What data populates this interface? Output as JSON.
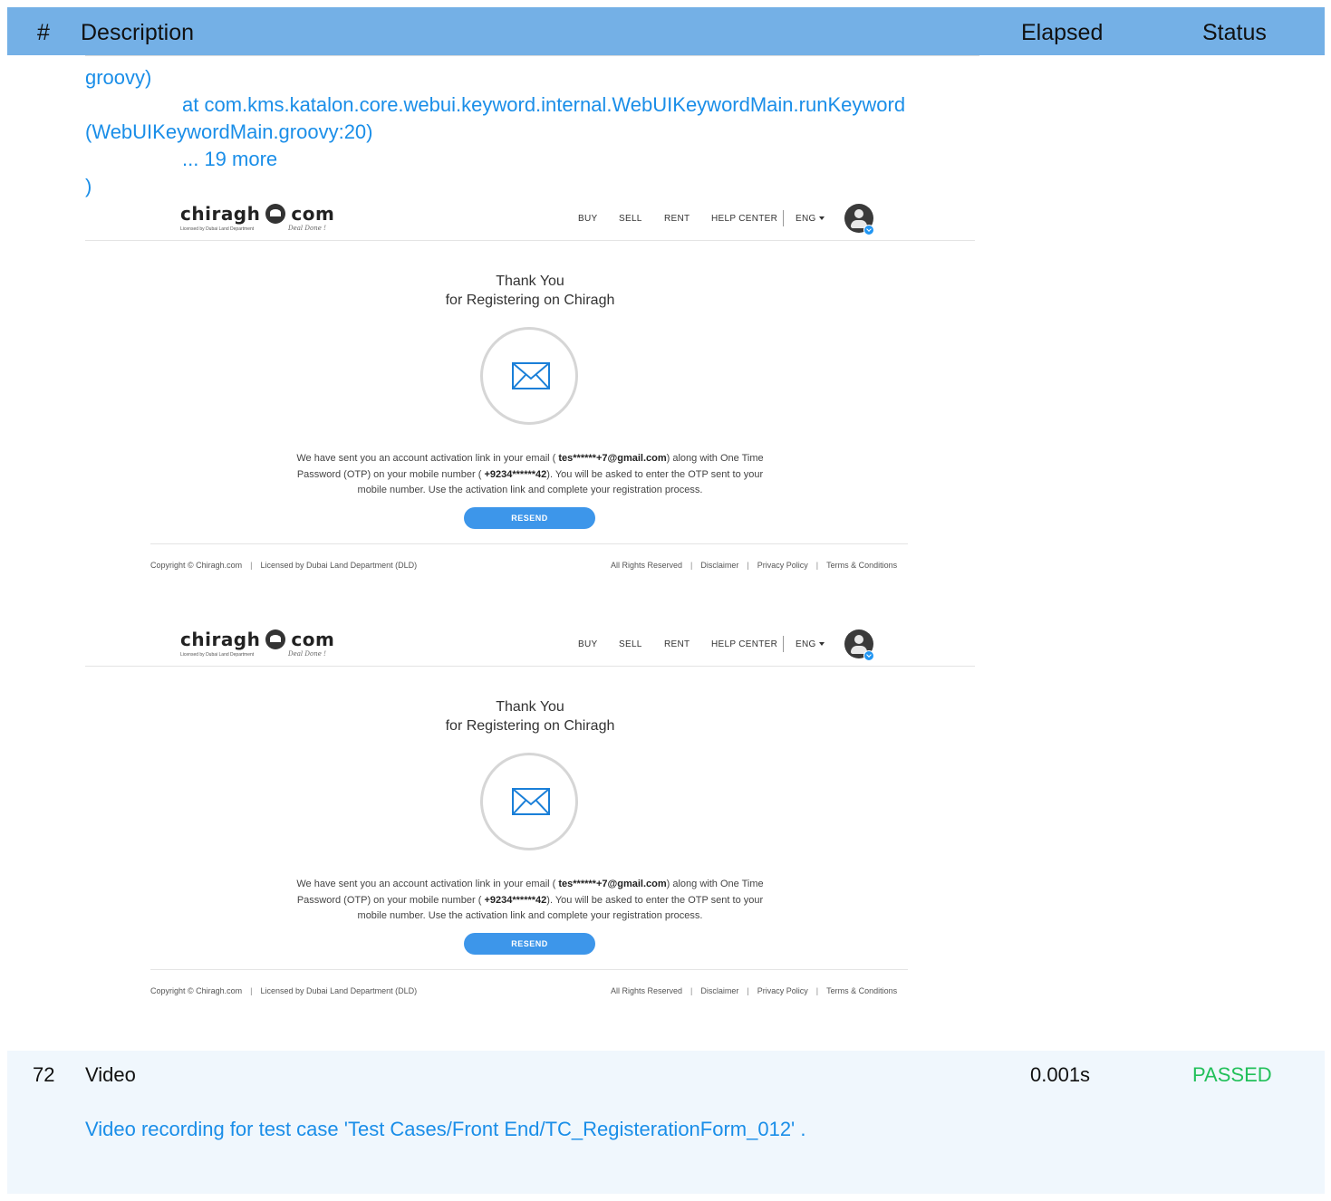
{
  "header": {
    "num": "#",
    "description": "Description",
    "elapsed": "Elapsed",
    "status": "Status"
  },
  "trace": {
    "line1": "groovy)",
    "line2": "at com.kms.katalon.core.webui.keyword.internal.WebUIKeywordMain.runKeyword",
    "line3": "(WebUIKeywordMain.groovy:20)",
    "line4": "... 19 more",
    "line5": ")"
  },
  "screenshot": {
    "logo_left": "chiragh",
    "logo_right": "com",
    "logo_sub": "Licensed by Dubai Land Department",
    "logo_tag": "Deal Done !",
    "nav": {
      "buy": "BUY",
      "sell": "SELL",
      "rent": "RENT",
      "help": "HELP CENTER",
      "lang": "ENG"
    },
    "thanks_line1": "Thank You",
    "thanks_line2": "for Registering on Chiragh",
    "msg_part1": "We have sent you an account activation link in your email ( ",
    "msg_email": "tes******+7@gmail.com",
    "msg_part2": ") along with One Time Password (OTP) on your mobile number ( ",
    "msg_phone": "+9234******42",
    "msg_part3": "). You will be asked to enter the OTP sent to your mobile number. Use the activation link and complete your registration process.",
    "resend": "RESEND",
    "footer": {
      "copyright": "Copyright © Chiragh.com",
      "licensed": "Licensed by Dubai Land Department (DLD)",
      "rights": "All Rights Reserved",
      "disclaimer": "Disclaimer",
      "privacy": "Privacy Policy",
      "terms": "Terms & Conditions"
    }
  },
  "row": {
    "num": "72",
    "name": "Video",
    "elapsed": "0.001s",
    "status": "PASSED",
    "status_color": "#22c05a",
    "message": "Video recording for test case 'Test Cases/Front End/TC_RegisterationForm_012' ."
  },
  "colors": {
    "header_bg": "#74b0e6",
    "link_blue": "#1a8ee8",
    "button_blue": "#3d96ea",
    "row_bg": "#f0f7fd"
  }
}
